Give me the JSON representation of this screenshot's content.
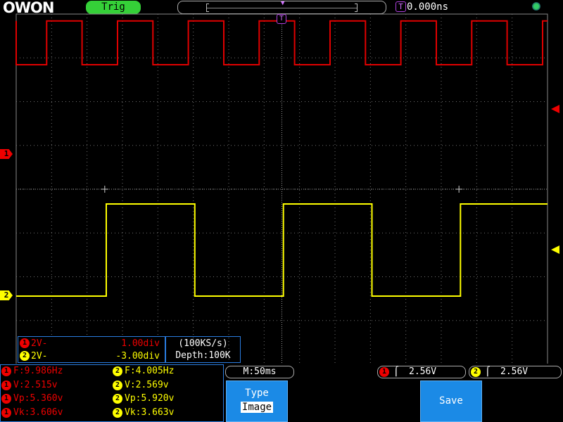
{
  "header": {
    "logo": "OWON",
    "trig_status": "Trig",
    "trigger_time_icon": "T",
    "trigger_time": "0.000ns",
    "usb_icon": "usb-icon"
  },
  "screen": {
    "trigger_position_marker": "T",
    "ch1_marker": "1",
    "ch2_marker": "2",
    "ch1_color": "#e00000",
    "ch2_color": "#ffff00",
    "ch1_waveform": {
      "period_ms": 100,
      "duty": 0.5,
      "high_div": 1.0,
      "low_div": 0.0,
      "first_edge_ms": -7
    },
    "ch2_waveform": {
      "period_ms": 250,
      "duty": 0.5,
      "high_div": -1.0,
      "low_div": -2.0,
      "first_edge_ms": 51
    }
  },
  "channel_settings": {
    "ch1": {
      "num": "1",
      "volts": "2V-",
      "offset": "1.00div"
    },
    "ch2": {
      "num": "2",
      "volts": "2V-",
      "offset": "-3.00div"
    }
  },
  "acquisition": {
    "sample_rate": "(100KS/s)",
    "depth": "Depth:100K"
  },
  "measurements": {
    "ch1": [
      {
        "num": "1",
        "text": "F:9.986Hz"
      },
      {
        "num": "1",
        "text": "V:2.515v"
      },
      {
        "num": "1",
        "text": "Vp:5.360v"
      },
      {
        "num": "1",
        "text": "Vk:3.606v"
      }
    ],
    "ch2": [
      {
        "num": "2",
        "text": "F:4.005Hz"
      },
      {
        "num": "2",
        "text": "V:2.569v"
      },
      {
        "num": "2",
        "text": "Vp:5.920v"
      },
      {
        "num": "2",
        "text": "Vk:3.663v"
      }
    ]
  },
  "timebase": "M:50ms",
  "trigger": {
    "ch1": {
      "num": "1",
      "edge": "⌠",
      "level": "2.56V"
    },
    "ch2": {
      "num": "2",
      "edge": "⌠",
      "level": "2.56V"
    }
  },
  "softkeys": {
    "type_label": "Type",
    "type_value": "Image",
    "save_label": "Save"
  }
}
